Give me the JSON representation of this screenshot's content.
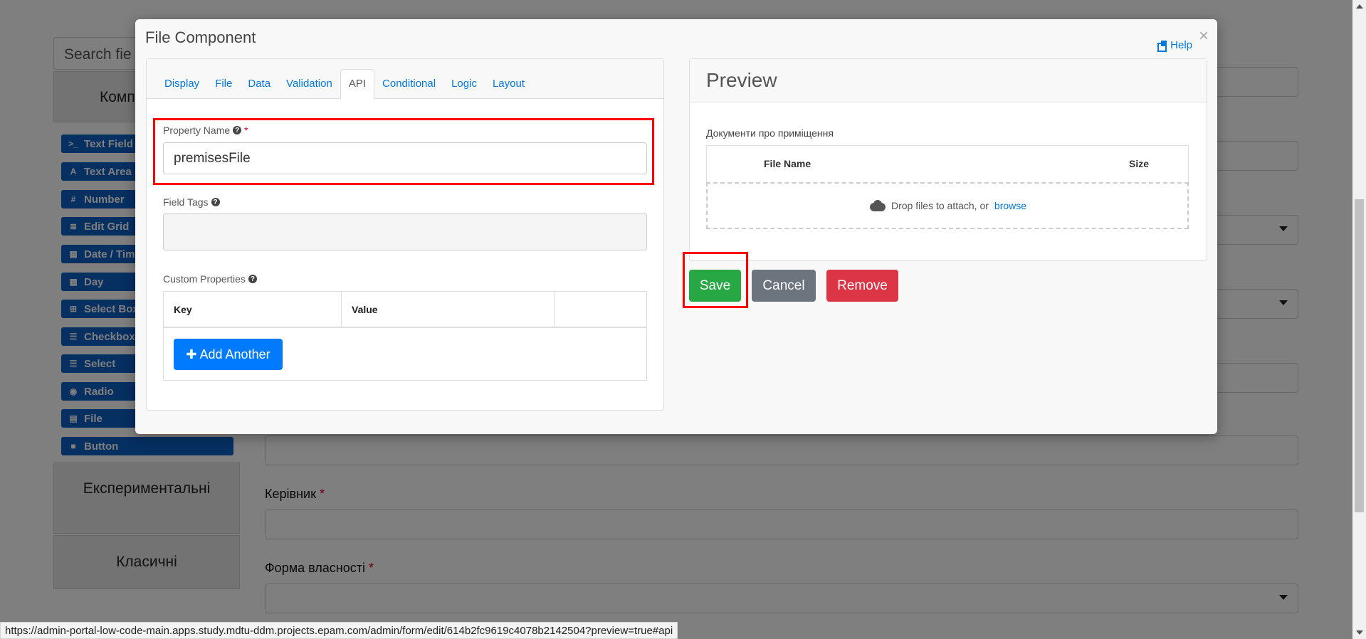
{
  "background": {
    "search_placeholder": "Search fie",
    "component_group_label": "Комп",
    "palette": [
      {
        "icon": ">_",
        "label": "Text Field"
      },
      {
        "icon": "A",
        "label": "Text Area"
      },
      {
        "icon": "#",
        "label": "Number"
      },
      {
        "icon": "≣",
        "label": "Edit Grid"
      },
      {
        "icon": "▦",
        "label": "Date / Tim"
      },
      {
        "icon": "▦",
        "label": "Day"
      },
      {
        "icon": "⊞",
        "label": "Select Box"
      },
      {
        "icon": "☰",
        "label": "Checkbox"
      },
      {
        "icon": "☰",
        "label": "Select"
      },
      {
        "icon": "◉",
        "label": "Radio"
      },
      {
        "icon": "▤",
        "label": "File"
      },
      {
        "icon": "■",
        "label": "Button"
      }
    ],
    "group_experimental": "Експериментальні",
    "group_classic": "Класичні",
    "field_label_manager": "Керівник",
    "field_label_ownership": "Форма власності",
    "required_mark": "*"
  },
  "status_url": "https://admin-portal-low-code-main.apps.study.mdtu-ddm.projects.epam.com/admin/form/edit/614b2fc9619c4078b2142504?preview=true#api",
  "modal": {
    "title": "File Component",
    "help_label": "Help",
    "close_glyph": "×",
    "tabs": [
      "Display",
      "File",
      "Data",
      "Validation",
      "API",
      "Conditional",
      "Logic",
      "Layout"
    ],
    "active_tab": "API",
    "property_name": {
      "label": "Property Name",
      "required": "*",
      "value": "premisesFile"
    },
    "field_tags": {
      "label": "Field Tags"
    },
    "custom_properties": {
      "label": "Custom Properties",
      "columns": [
        "Key",
        "Value",
        ""
      ],
      "add_button": "Add Another",
      "add_icon": "✚"
    },
    "preview": {
      "title": "Preview",
      "field_label": "Документи про приміщення",
      "columns": [
        "File Name",
        "Size"
      ],
      "drop_text": "Drop files to attach, or",
      "browse_link": "browse"
    },
    "buttons": {
      "save": "Save",
      "cancel": "Cancel",
      "remove": "Remove"
    },
    "colors": {
      "save": "#28a745",
      "cancel": "#6c757d",
      "remove": "#dc3545",
      "primary": "#007bff",
      "highlight": "#ff0000"
    }
  }
}
